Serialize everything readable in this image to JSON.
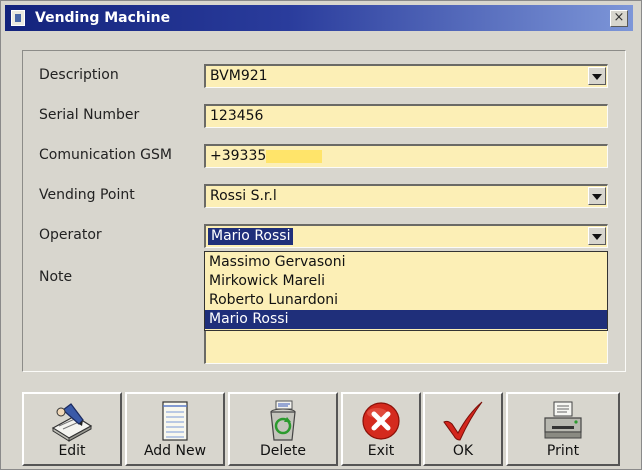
{
  "window": {
    "title": "Vending Machine",
    "close_glyph": "×"
  },
  "form": {
    "description_label": "Description",
    "description_value": "BVM921",
    "serial_label": "Serial Number",
    "serial_value": "123456",
    "gsm_label": "Comunication GSM",
    "gsm_value": "+39335",
    "vending_point_label": "Vending Point",
    "vending_point_value": "Rossi S.r.l",
    "operator_label": "Operator",
    "operator_value": "Mario Rossi",
    "note_label": "Note"
  },
  "operator_options": [
    "Massimo Gervasoni",
    "Mirkowick Mareli",
    "Roberto Lunardoni",
    "Mario Rossi"
  ],
  "operator_selected_index": 3,
  "toolbar": {
    "edit_label": "Edit",
    "add_new_label": "Add New",
    "delete_label": "Delete",
    "exit_label": "Exit",
    "ok_label": "OK",
    "print_label": "Print"
  },
  "icons": {
    "edit": "edit-icon",
    "add_new": "notebook-icon",
    "delete": "recycle-bin-icon",
    "exit": "close-circle-icon",
    "ok": "checkmark-icon",
    "print": "printer-icon"
  },
  "colors": {
    "title_bar": "#13237c",
    "field_background": "#fcefb6",
    "selection": "#1f2f7a",
    "exit_red": "#d42a1e",
    "ok_red": "#d3261d"
  }
}
